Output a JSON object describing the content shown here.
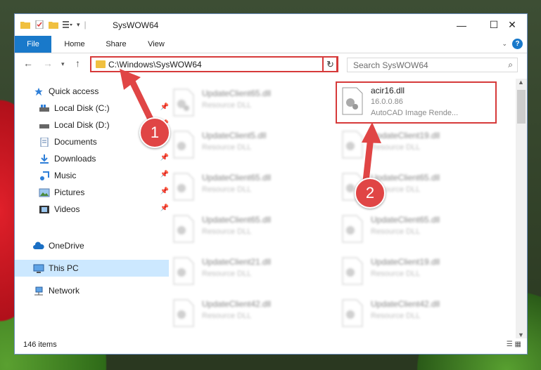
{
  "window": {
    "title": "SysWOW64",
    "controls": {
      "minimize": "—",
      "maximize": "☐",
      "close": "✕"
    }
  },
  "ribbon": {
    "tabs": [
      "File",
      "Home",
      "Share",
      "View"
    ],
    "help": "?"
  },
  "address": {
    "path": "C:\\Windows\\SysWOW64",
    "search_placeholder": "Search SysWOW64"
  },
  "nav_pane": {
    "items": [
      {
        "label": "Quick access",
        "icon": "star-icon"
      },
      {
        "label": "Local Disk (C:)",
        "icon": "drive-icon"
      },
      {
        "label": "Local Disk (D:)",
        "icon": "drive-icon"
      },
      {
        "label": "Documents",
        "icon": "documents-icon"
      },
      {
        "label": "Downloads",
        "icon": "download-icon"
      },
      {
        "label": "Music",
        "icon": "music-icon"
      },
      {
        "label": "Pictures",
        "icon": "pictures-icon"
      },
      {
        "label": "Videos",
        "icon": "videos-icon"
      },
      {
        "label": "OneDrive",
        "icon": "cloud-icon"
      },
      {
        "label": "This PC",
        "icon": "computer-icon"
      },
      {
        "label": "Network",
        "icon": "network-icon"
      }
    ]
  },
  "files": [
    {
      "name": "UpdateClient65.dll",
      "type": "Resource DLL"
    },
    {
      "name": "acir16.dll",
      "version": "16.0.0.86",
      "type": "AutoCAD Image Rende..."
    },
    {
      "name": "UpdateClient5.dll",
      "type": "Resource DLL"
    },
    {
      "name": "UpdateClient19.dll",
      "type": "Resource DLL"
    },
    {
      "name": "UpdateClient65.dll",
      "type": "Resource DLL"
    },
    {
      "name": "UpdateClient65.dll",
      "type": "Resource DLL"
    },
    {
      "name": "UpdateClient65.dll",
      "type": "Resource DLL"
    },
    {
      "name": "UpdateClient65.dll",
      "type": "Resource DLL"
    },
    {
      "name": "UpdateClient21.dll",
      "type": "Resource DLL"
    },
    {
      "name": "UpdateClient19.dll",
      "type": "Resource DLL"
    },
    {
      "name": "UpdateClient42.dll",
      "type": "Resource DLL"
    },
    {
      "name": "UpdateClient42.dll",
      "type": "Resource DLL"
    }
  ],
  "status": {
    "count": "146 items"
  },
  "annotations": {
    "step1": "1",
    "step2": "2"
  },
  "colors": {
    "accent": "#1979ca",
    "highlight": "#d63a3a",
    "selected": "#cce8ff"
  }
}
